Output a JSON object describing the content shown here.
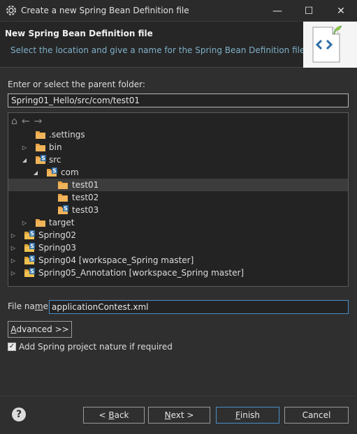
{
  "window": {
    "title": "Create a new Spring Bean Definition file",
    "minimize": "—",
    "maximize": "☐",
    "close": "✕"
  },
  "banner": {
    "title": "New Spring Bean Definition file",
    "description": "Select the location and give a name for the Spring Bean Definition file"
  },
  "parent_folder": {
    "label": "Enter or select the parent folder:",
    "value": "Spring01_Hello/src/com/test01"
  },
  "tree": {
    "toolbar": {
      "home": "⌂",
      "back": "←",
      "forward": "→"
    },
    "items": [
      {
        "label": ".settings"
      },
      {
        "label": "bin"
      },
      {
        "label": "src"
      },
      {
        "label": "com"
      },
      {
        "label": "test01"
      },
      {
        "label": "test02"
      },
      {
        "label": "test03"
      },
      {
        "label": "target"
      },
      {
        "label": "Spring02"
      },
      {
        "label": "Spring03"
      },
      {
        "label": "Spring04 [workspace_Spring master]"
      },
      {
        "label": "Spring05_Annotation [workspace_Spring master]"
      }
    ]
  },
  "file_name": {
    "label_pre": "File na",
    "label_mn": "m",
    "label_post": "e:",
    "value": "applicationContest.xml"
  },
  "advanced_button": {
    "mn": "A",
    "rest": "dvanced >>"
  },
  "checkbox": {
    "label": "Add Spring project nature if required",
    "checked": "✓"
  },
  "buttons": {
    "back": {
      "pre": "< ",
      "mn": "B",
      "rest": "ack"
    },
    "next": {
      "mn": "N",
      "rest": "ext >"
    },
    "finish": {
      "mn": "F",
      "rest": "inish"
    },
    "cancel": "Cancel",
    "help": "?"
  },
  "colors": {
    "folder": "#e8a243",
    "spring_badge": "#2e6da4",
    "accent": "#4a90c8",
    "link_text": "#7fb0c8"
  }
}
